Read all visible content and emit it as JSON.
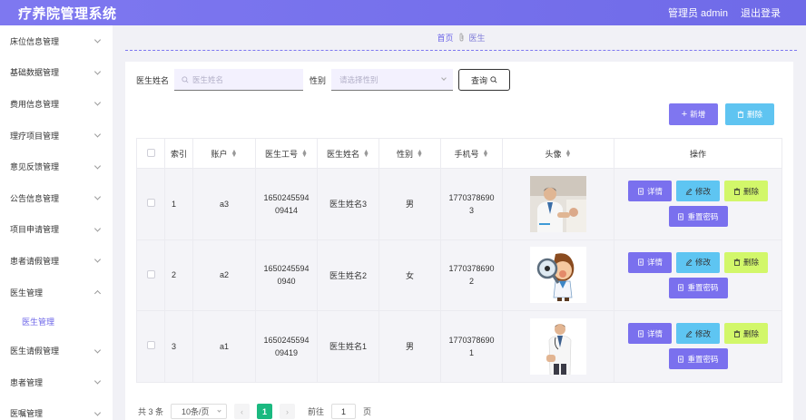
{
  "app": {
    "title": "疗养院管理系统",
    "user": "管理员 admin",
    "logout": "退出登录"
  },
  "sidebar": {
    "items": [
      {
        "label": "床位信息管理"
      },
      {
        "label": "基础数据管理"
      },
      {
        "label": "费用信息管理"
      },
      {
        "label": "理疗项目管理"
      },
      {
        "label": "意见反馈管理"
      },
      {
        "label": "公告信息管理"
      },
      {
        "label": "项目申请管理"
      },
      {
        "label": "患者请假管理"
      },
      {
        "label": "医生管理",
        "expanded": true,
        "children": [
          {
            "label": "医生管理",
            "active": true
          }
        ]
      },
      {
        "label": "医生请假管理"
      },
      {
        "label": "患者管理"
      },
      {
        "label": "医嘱管理"
      }
    ]
  },
  "breadcrumb": {
    "home": "首页",
    "separator_icon": "paperclip-icon",
    "current": "医生"
  },
  "search": {
    "name_label": "医生姓名",
    "name_placeholder": "医生姓名",
    "gender_label": "性别",
    "gender_placeholder": "请选择性别",
    "query_label": "查询"
  },
  "toolbar": {
    "add_label": "新增",
    "delete_label": "删除"
  },
  "table": {
    "headers": {
      "index": "索引",
      "account": "账户",
      "job_no": "医生工号",
      "name": "医生姓名",
      "gender": "性别",
      "phone": "手机号",
      "avatar": "头像",
      "actions": "操作"
    },
    "rows": [
      {
        "index": "1",
        "account": "a3",
        "job_no": "1650245594 09414",
        "name": "医生姓名3",
        "gender": "男",
        "phone": "1770378690 3",
        "avatar": "doctor-with-patient-photo"
      },
      {
        "index": "2",
        "account": "a2",
        "job_no": "1650245594 0940",
        "name": "医生姓名2",
        "gender": "女",
        "phone": "1770378690 2",
        "avatar": "cartoon-doctor-magnifier"
      },
      {
        "index": "3",
        "account": "a1",
        "job_no": "1650245594 09419",
        "name": "医生姓名1",
        "gender": "男",
        "phone": "1770378690 1",
        "avatar": "doctor-standing-photo"
      }
    ],
    "actions": {
      "detail": "详情",
      "edit": "修改",
      "delete": "删除",
      "reset": "重置密码"
    }
  },
  "pagination": {
    "total": "共 3 条",
    "page_size": "10条/页",
    "current_page": "1",
    "goto_label": "前往",
    "goto_value": "1",
    "page_suffix": "页"
  },
  "colors": {
    "primary": "#7a70ee",
    "info": "#5ec5f2",
    "warn": "#d2f76a",
    "pager_active": "#1bb980"
  }
}
